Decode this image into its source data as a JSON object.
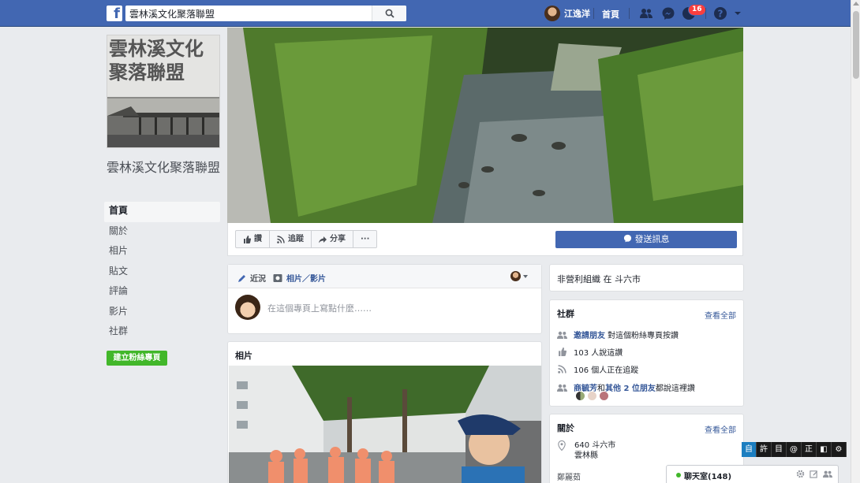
{
  "topbar": {
    "search_value": "雲林溪文化聚落聯盟",
    "user_name": "江逸洋",
    "home_label": "首頁",
    "notification_count": "16"
  },
  "page": {
    "photo_title": "雲林溪文化聚落聯盟",
    "name": "雲林溪文化聚落聯盟",
    "create_page_label": "建立粉絲專頁"
  },
  "left_nav": [
    {
      "label": "首頁",
      "active": true
    },
    {
      "label": "關於"
    },
    {
      "label": "相片"
    },
    {
      "label": "貼文"
    },
    {
      "label": "評論"
    },
    {
      "label": "影片"
    },
    {
      "label": "社群"
    }
  ],
  "actions": {
    "like": "讚",
    "follow": "追蹤",
    "share": "分享",
    "more": "···",
    "send_message": "發送訊息"
  },
  "composer": {
    "tab_status": "近況",
    "tab_photo": "相片／影片",
    "placeholder": "在這個專頁上寫點什麼……"
  },
  "photos": {
    "title": "相片"
  },
  "right": {
    "category_line": "非營利組織 在 斗六市",
    "community": {
      "title": "社群",
      "see_all": "查看全部",
      "invite_link": "邀請朋友",
      "invite_text": "對這個粉絲專頁按讚",
      "likes": "103 人說這讚",
      "follows": "106 個人正在追蹤",
      "friend_name": "商毓芳",
      "friend_mid": "和",
      "friend_others": "其他 2 位朋友",
      "friend_tail": "都說這裡讚"
    },
    "about": {
      "title": "關於",
      "see_all": "查看全部",
      "address_line1": "640 斗六市",
      "address_line2": "雲林縣",
      "bottom_text": "鄭麗茹"
    }
  },
  "chat": {
    "label": "聊天室(148)"
  },
  "ime": [
    "自",
    "許",
    "目",
    "@",
    "正",
    "◧",
    "⚙"
  ]
}
